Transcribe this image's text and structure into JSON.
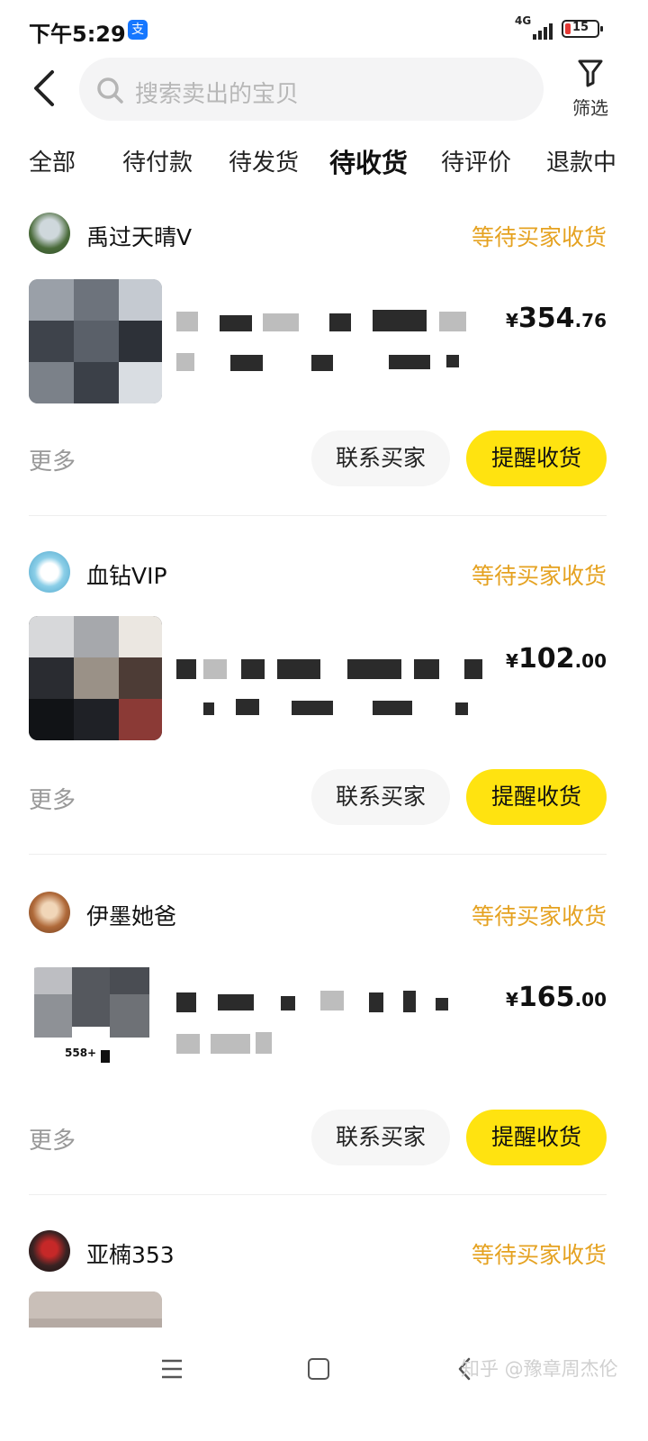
{
  "status_bar": {
    "time": "下午5:29",
    "alipay_badge": "支",
    "network": "4G",
    "battery": "15"
  },
  "search": {
    "placeholder": "搜索卖出的宝贝"
  },
  "filter": {
    "label": "筛选"
  },
  "tabs": [
    {
      "label": "全部"
    },
    {
      "label": "待付款"
    },
    {
      "label": "待发货"
    },
    {
      "label": "待收货",
      "active": true
    },
    {
      "label": "待评价"
    },
    {
      "label": "退款中"
    }
  ],
  "orders": [
    {
      "buyer": "禹过天晴V",
      "status": "等待买家收货",
      "price_symbol": "¥",
      "price_int": "354",
      "price_dec": ".76",
      "more": "更多",
      "contact": "联系买家",
      "remind": "提醒收货"
    },
    {
      "buyer": "血钻VIP",
      "status": "等待买家收货",
      "price_symbol": "¥",
      "price_int": "102",
      "price_dec": ".00",
      "more": "更多",
      "contact": "联系买家",
      "remind": "提醒收货"
    },
    {
      "buyer": "伊墨她爸",
      "status": "等待买家收货",
      "price_symbol": "¥",
      "price_int": "165",
      "price_dec": ".00",
      "more": "更多",
      "contact": "联系买家",
      "remind": "提醒收货",
      "thumb_badge": "558+"
    },
    {
      "buyer": "亚楠353",
      "status": "等待买家收货"
    }
  ],
  "watermark": "知乎 @豫章周杰伦",
  "colors": {
    "accent_yellow": "#ffe310",
    "status_orange": "#e5a221"
  }
}
